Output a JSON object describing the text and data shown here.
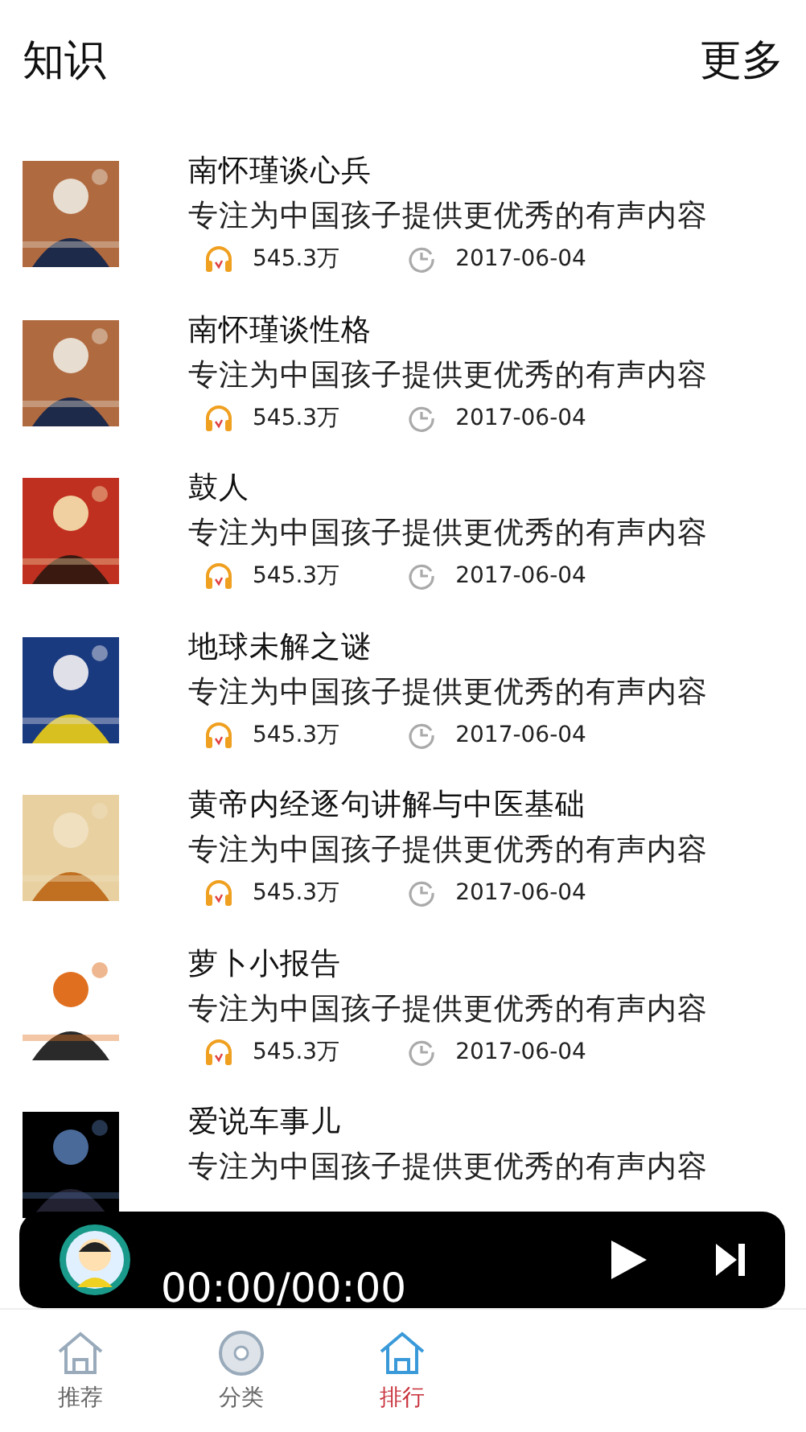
{
  "header": {
    "title": "知识",
    "more": "更多"
  },
  "items": [
    {
      "title": "南怀瑾谈心兵",
      "description": "专注为中国孩子提供更优秀的有声内容",
      "plays": "545.3万",
      "date": "2017-06-04"
    },
    {
      "title": "南怀瑾谈性格",
      "description": "专注为中国孩子提供更优秀的有声内容",
      "plays": "545.3万",
      "date": "2017-06-04"
    },
    {
      "title": "鼓人",
      "description": "专注为中国孩子提供更优秀的有声内容",
      "plays": "545.3万",
      "date": "2017-06-04"
    },
    {
      "title": "地球未解之谜",
      "description": "专注为中国孩子提供更优秀的有声内容",
      "plays": "545.3万",
      "date": "2017-06-04"
    },
    {
      "title": "黄帝内经逐句讲解与中医基础",
      "description": "专注为中国孩子提供更优秀的有声内容",
      "plays": "545.3万",
      "date": "2017-06-04"
    },
    {
      "title": "萝卜小报告",
      "description": "专注为中国孩子提供更优秀的有声内容",
      "plays": "545.3万",
      "date": "2017-06-04"
    },
    {
      "title": "爱说车事儿",
      "description": "专注为中国孩子提供更优秀的有声内容"
    }
  ],
  "player": {
    "time": "00:00/00:00"
  },
  "tabs": [
    {
      "label": "推荐",
      "kind": "home",
      "selected": false
    },
    {
      "label": "分类",
      "kind": "disc",
      "selected": false
    },
    {
      "label": "排行",
      "kind": "home",
      "selected": true
    }
  ]
}
